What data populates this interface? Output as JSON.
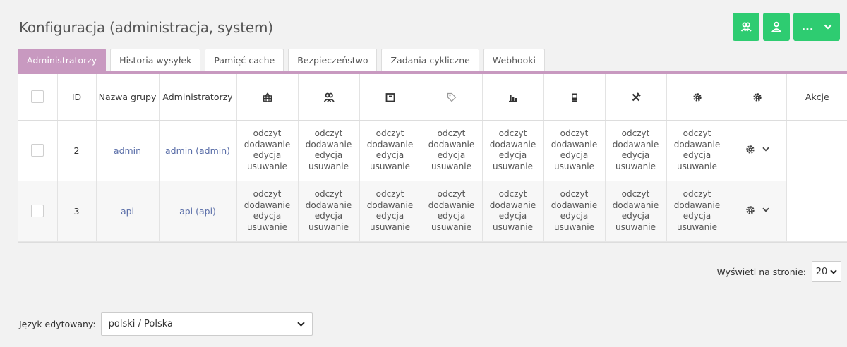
{
  "title": "Konfiguracja (administracja, system)",
  "top_actions": {
    "more_label": "...",
    "accent": "#2ecc71"
  },
  "tabs": [
    {
      "label": "Administratorzy",
      "active": true
    },
    {
      "label": "Historia wysyłek",
      "active": false
    },
    {
      "label": "Pamięć cache",
      "active": false
    },
    {
      "label": "Bezpieczeństwo",
      "active": false
    },
    {
      "label": "Zadania cykliczne",
      "active": false
    },
    {
      "label": "Webhooki",
      "active": false
    }
  ],
  "table": {
    "headers": {
      "id": "ID",
      "group": "Nazwa grupy",
      "admins": "Administratorzy",
      "actions": "Akcje"
    },
    "permission_columns": [
      "basket-icon",
      "users-icon",
      "box-icon",
      "tag-icon",
      "chart-icon",
      "document-icon",
      "tools-icon",
      "settings-icon"
    ],
    "rows": [
      {
        "id": "2",
        "group": "admin",
        "admins": "admin (admin)",
        "permissions": [
          "odczyt",
          "dodawanie",
          "edycja",
          "usuwanie"
        ]
      },
      {
        "id": "3",
        "group": "api",
        "admins": "api (api)",
        "permissions": [
          "odczyt",
          "dodawanie",
          "edycja",
          "usuwanie"
        ]
      }
    ]
  },
  "pager": {
    "label": "Wyświetl na stronie:",
    "value": "20"
  },
  "language": {
    "label": "Język edytowany:",
    "value": "polski / Polska"
  },
  "colors": {
    "tab_active": "#c899c0",
    "link": "#5a6ea8",
    "button": "#2ecc71"
  }
}
